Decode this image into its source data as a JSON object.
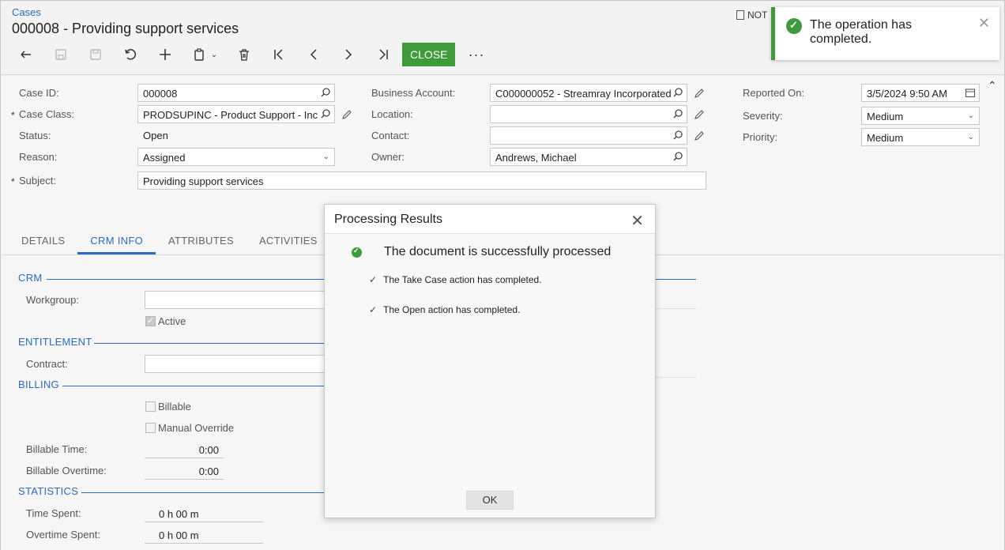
{
  "header": {
    "breadcrumb": "Cases",
    "title": "000008 - Providing support services",
    "notes_label": "NOT",
    "close_label": "CLOSE",
    "more_label": "···"
  },
  "toolbar_icons": [
    "undo-icon",
    "save-close-icon",
    "save-icon",
    "cancel-icon",
    "add-icon",
    "copy-paste-icon",
    "delete-icon",
    "first-icon",
    "previous-icon",
    "next-icon",
    "last-icon"
  ],
  "form": {
    "case_id": {
      "label": "Case ID:",
      "value": "000008"
    },
    "case_class": {
      "label": "Case Class:",
      "value": "PRODSUPINC - Product Support - Inc"
    },
    "status": {
      "label": "Status:",
      "value": "Open"
    },
    "reason": {
      "label": "Reason:",
      "value": "Assigned"
    },
    "subject": {
      "label": "Subject:",
      "value": "Providing support services"
    },
    "business_account": {
      "label": "Business Account:",
      "value": "C000000052 - Streamray Incorporated"
    },
    "location": {
      "label": "Location:",
      "value": ""
    },
    "contact": {
      "label": "Contact:",
      "value": ""
    },
    "owner": {
      "label": "Owner:",
      "value": "Andrews, Michael"
    },
    "reported_on": {
      "label": "Reported On:",
      "value": "3/5/2024 9:50 AM"
    },
    "severity": {
      "label": "Severity:",
      "value": "Medium"
    },
    "priority": {
      "label": "Priority:",
      "value": "Medium"
    }
  },
  "tabs": [
    "DETAILS",
    "CRM INFO",
    "ATTRIBUTES",
    "ACTIVITIES"
  ],
  "crm": {
    "crm_title": "CRM",
    "workgroup_label": "Workgroup:",
    "active_label": "Active",
    "entitlement_title": "ENTITLEMENT",
    "contract_label": "Contract:",
    "billing_title": "BILLING",
    "billable_label": "Billable",
    "manual_override_label": "Manual Override",
    "billable_time_label": "Billable Time:",
    "billable_time_value": "0:00",
    "billable_overtime_label": "Billable Overtime:",
    "billable_overtime_value": "0:00",
    "statistics_title": "STATISTICS",
    "time_spent_label": "Time Spent:",
    "time_spent_value": "0 h 00 m",
    "overtime_spent_label": "Overtime Spent:",
    "overtime_spent_value": "0 h 00 m"
  },
  "toast": {
    "message": "The operation has completed.",
    "accent": "#3e9a3a"
  },
  "dialog": {
    "title": "Processing Results",
    "headline": "The document is successfully processed",
    "lines": [
      "The Take Case action has completed.",
      "The Open action has completed."
    ],
    "ok_label": "OK"
  }
}
